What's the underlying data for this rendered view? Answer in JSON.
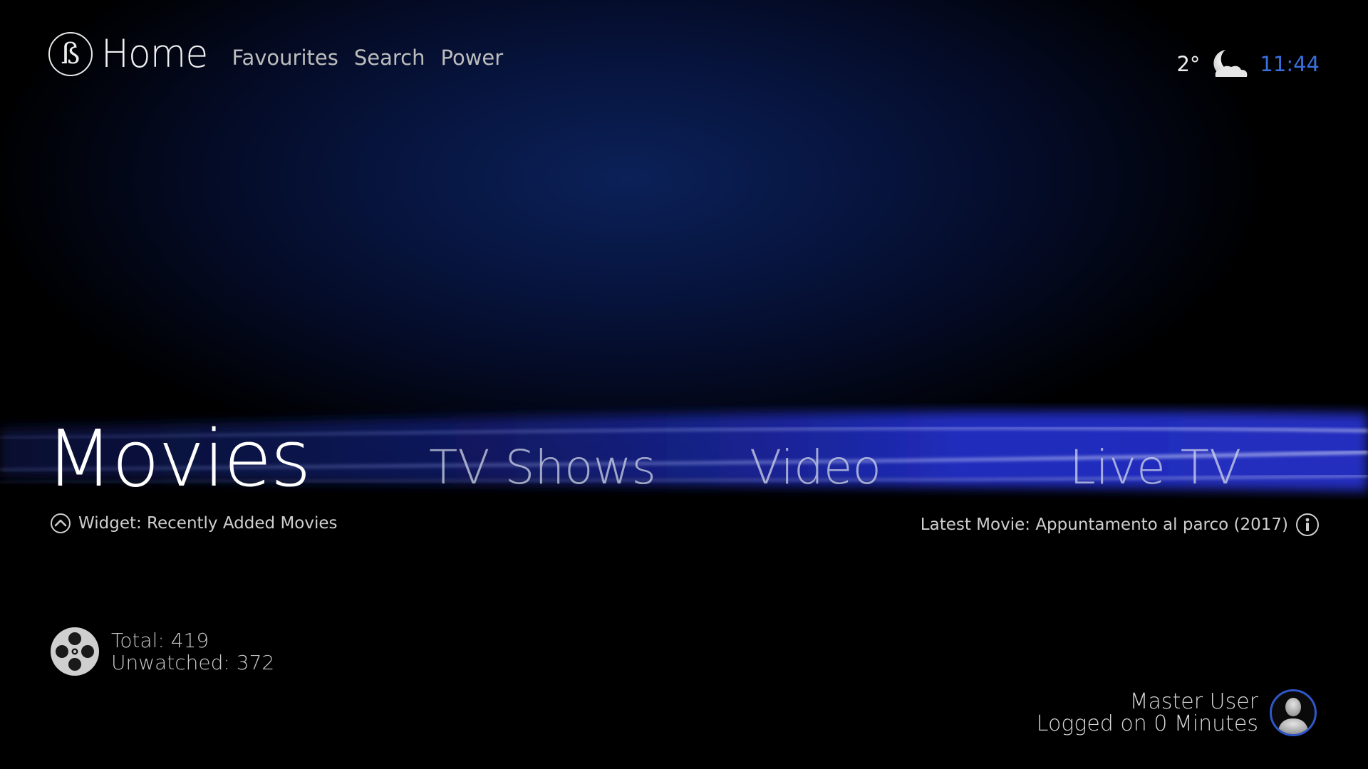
{
  "header": {
    "logo_glyph": "ß",
    "title": "Home",
    "nav": [
      "Favourites",
      "Search",
      "Power"
    ]
  },
  "status": {
    "temperature": "2°",
    "weather_icon": "moon-cloud-icon",
    "time": "11:44",
    "time_color": "#3a6fe0"
  },
  "menu": {
    "items": [
      "Movies",
      "TV Shows",
      "Video",
      "Live TV"
    ],
    "active_index": 0
  },
  "widget": {
    "label": "Widget: Recently Added Movies",
    "icon": "chevron-up-circle-icon"
  },
  "latest": {
    "label": "Latest Movie: Appuntamento al parco (2017)",
    "icon": "info-icon"
  },
  "stats": {
    "icon": "film-reel-icon",
    "total": "Total: 419",
    "unwatched": "Unwatched: 372"
  },
  "user": {
    "name": "Master User",
    "session": "Logged on 0 Minutes",
    "avatar_icon": "user-avatar-icon",
    "accent": "#2f57c9"
  }
}
